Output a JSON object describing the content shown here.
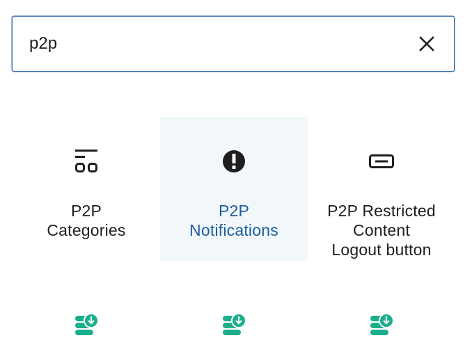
{
  "search": {
    "value": "p2p",
    "clear_icon": "close-icon"
  },
  "blocks": [
    {
      "label": "P2P\nCategories",
      "icon": "categories-icon",
      "active": false
    },
    {
      "label": "P2P\nNotifications",
      "icon": "alert-icon",
      "active": true
    },
    {
      "label": "P2P Restricted\nContent\nLogout button",
      "icon": "button-icon",
      "active": false
    },
    {
      "label": "",
      "icon": "database-download-icon",
      "active": false
    },
    {
      "label": "",
      "icon": "database-download-icon",
      "active": false
    },
    {
      "label": "",
      "icon": "database-download-icon",
      "active": false
    }
  ],
  "colors": {
    "accent": "#1c5e9c",
    "input_border": "#3b6fae",
    "active_bg": "#f2f7fa",
    "database_icon": "#1aae8b"
  }
}
